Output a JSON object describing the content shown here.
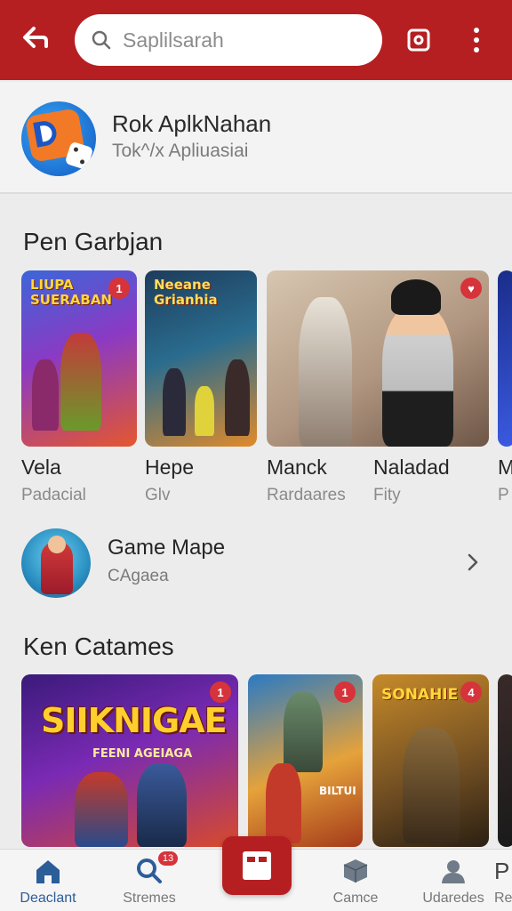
{
  "colors": {
    "accent": "#b51f22",
    "badge": "#d6333a",
    "active_nav": "#2c5d99"
  },
  "search": {
    "placeholder": "Saplilsarah"
  },
  "featured": {
    "title": "Rok  AplkNahan",
    "subtitle": "Tok^/x Apliuasiai"
  },
  "section1": {
    "title": "Pen Garbjan",
    "cards": [
      {
        "name": "Vela",
        "sub": "Padacial",
        "art_text": "LIUPA SUERABAN",
        "badge": "1"
      },
      {
        "name": "Hepe",
        "sub": "Glv",
        "art_text": "Neeane Grianhia",
        "badge": ""
      },
      {
        "name": "Manck",
        "sub": "Rardaares",
        "art_text": "",
        "badge": ""
      },
      {
        "name": "Naladad",
        "sub": "Fity",
        "art_text": "",
        "badge": ""
      },
      {
        "name": "M",
        "sub": "P",
        "art_text": "",
        "badge": ""
      }
    ]
  },
  "row_item": {
    "title": "Game Mape",
    "subtitle": "CAgaea"
  },
  "section2": {
    "title": "Ken Catames",
    "cards": [
      {
        "art_title": "SIIKNIGAE",
        "art_sub": "FEENI AGEIAGA",
        "badge": "1"
      },
      {
        "art_title": "BILTUI",
        "art_sub": "",
        "badge": "1"
      },
      {
        "art_title": "SONAHIE",
        "art_sub": "",
        "badge": "4"
      },
      {
        "art_title": "",
        "art_sub": "",
        "badge": ""
      }
    ]
  },
  "bottom_nav": [
    {
      "label": "Deaclant",
      "icon": "home-icon",
      "active": true,
      "badge": ""
    },
    {
      "label": "Stremes",
      "icon": "search-icon",
      "active": false,
      "badge": "13"
    },
    {
      "label": "",
      "icon": "center-app-icon",
      "active": false,
      "badge": ""
    },
    {
      "label": "Camce",
      "icon": "box-icon",
      "active": false,
      "badge": ""
    },
    {
      "label": "Udaredes",
      "icon": "user-icon",
      "active": false,
      "badge": ""
    },
    {
      "label": "Re",
      "icon": "p-icon",
      "active": false,
      "badge": ""
    }
  ]
}
